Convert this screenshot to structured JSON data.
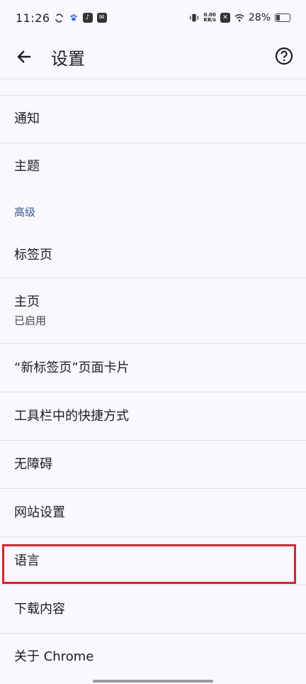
{
  "status_bar": {
    "time": "11:26",
    "net_speed_value": "0.00",
    "net_speed_unit": "KB/s",
    "battery_percent": "28%"
  },
  "app_bar": {
    "title": "设置",
    "back_icon": "arrow-back-icon",
    "help_icon": "help-circle-icon"
  },
  "settings": {
    "notifications": "通知",
    "theme": "主题",
    "advanced_header": "高级",
    "tabs": "标签页",
    "homepage": "主页",
    "homepage_status": "已启用",
    "ntp_cards": "“新标签页”页面卡片",
    "toolbar_shortcut": "工具栏中的快捷方式",
    "accessibility": "无障碍",
    "site_settings": "网站设置",
    "languages": "语言",
    "downloads": "下载内容",
    "about_chrome": "关于 Chrome"
  },
  "colors": {
    "background": "#f8f8fd",
    "section_header": "#3a5a8c",
    "highlight_border": "#d62336"
  }
}
